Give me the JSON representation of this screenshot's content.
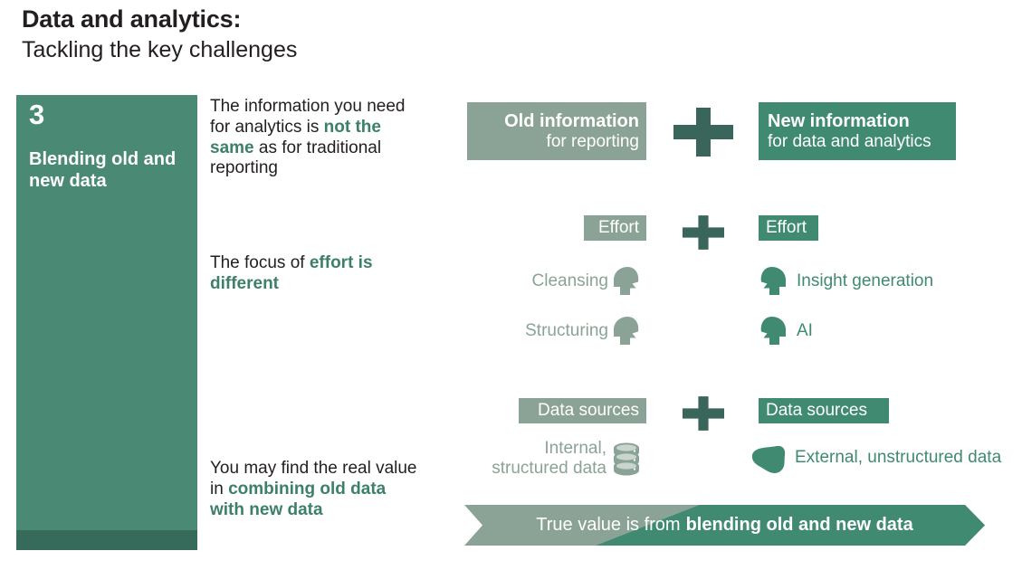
{
  "header": {
    "title": "Data and analytics:",
    "subtitle": "Tackling the key challenges"
  },
  "panel": {
    "number": "3",
    "label": "Blending old and new data"
  },
  "text_column": {
    "block1": {
      "pre": "The information you need for analytics is ",
      "highlight": "not the same",
      "post": " as for traditional reporting"
    },
    "block2": {
      "pre": "The focus of ",
      "highlight": "effort is different",
      "post": ""
    },
    "block3": {
      "pre": "You may find the real value in ",
      "highlight": "combining old data with new data",
      "post": ""
    }
  },
  "diagram": {
    "row_information": {
      "old": {
        "line1": "Old information",
        "line2": "for reporting"
      },
      "plus": "plus-icon",
      "new": {
        "line1": "New information",
        "line2": "for data and analytics"
      }
    },
    "row_effort": {
      "old_chip": "Effort",
      "plus": "plus-icon",
      "new_chip": "Effort",
      "old_items": [
        "Cleansing",
        "Structuring"
      ],
      "new_items": [
        "Insight generation",
        "AI"
      ]
    },
    "row_sources": {
      "old_chip": "Data sources",
      "plus": "plus-icon",
      "new_chip": "Data sources",
      "old_item": "Internal, structured data",
      "new_item": "External, unstructured data"
    }
  },
  "banner": {
    "prefix": "True value is from",
    "emphasis": "blending old and new data"
  },
  "colors": {
    "green": "#4a8a74",
    "green_dark": "#366b5b",
    "green_chip": "#3f8a71",
    "green_text": "#3d8068",
    "gray_green": "#8ba396",
    "plus_green": "#3a655a",
    "text": "#231f20",
    "white": "#ffffff"
  }
}
